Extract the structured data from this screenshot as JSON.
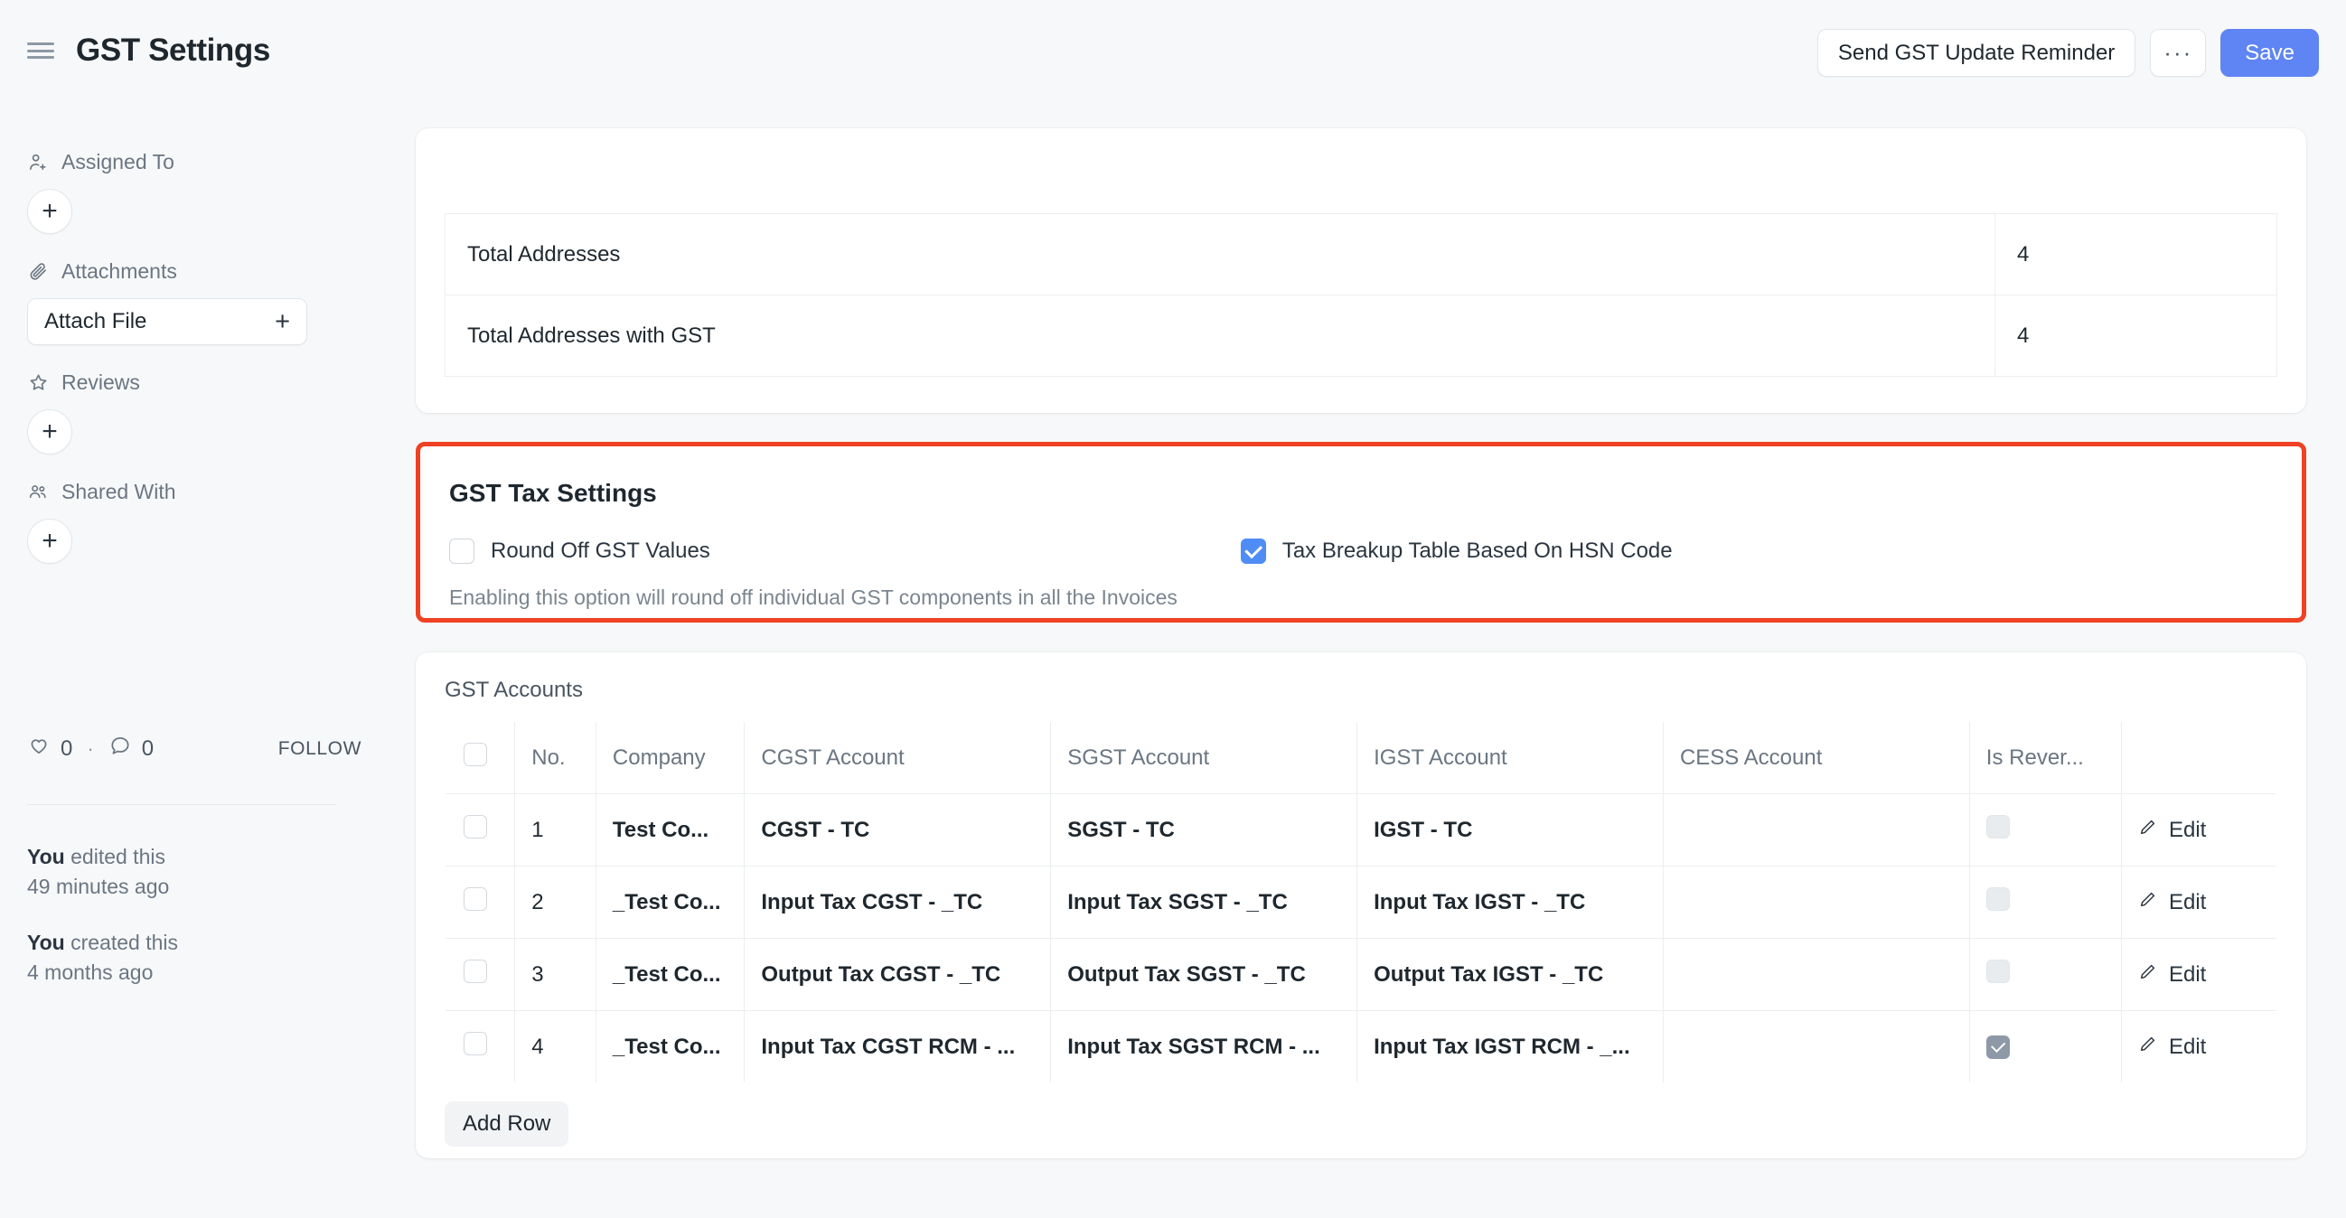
{
  "header": {
    "title": "GST Settings",
    "menu_icon": "hamburger-icon",
    "reminder_button": "Send GST Update Reminder",
    "more_button": "···",
    "save_button": "Save"
  },
  "sidebar": {
    "assigned_to": {
      "label": "Assigned To",
      "icon": "user-plus-icon",
      "add": "+"
    },
    "attachments": {
      "label": "Attachments",
      "icon": "paperclip-icon",
      "attach_label": "Attach File",
      "attach_plus": "+"
    },
    "reviews": {
      "label": "Reviews",
      "icon": "star-icon",
      "add": "+"
    },
    "shared_with": {
      "label": "Shared With",
      "icon": "users-icon",
      "add": "+"
    },
    "social": {
      "like_count": "0",
      "separator": "·",
      "comment_count": "0",
      "follow": "FOLLOW"
    },
    "activity": [
      {
        "who": "You",
        "action": " edited this",
        "time": "49 minutes ago"
      },
      {
        "who": "You",
        "action": " created this",
        "time": "4 months ago"
      }
    ]
  },
  "addresses": {
    "rows": [
      {
        "label": "Total Addresses",
        "value": "4"
      },
      {
        "label": "Total Addresses with GST",
        "value": "4"
      }
    ]
  },
  "gst_tax_settings": {
    "title": "GST Tax Settings",
    "highlight_color": "#ef4123",
    "accent_color": "#4f8df5",
    "round_off": {
      "label": "Round Off GST Values",
      "checked": false
    },
    "hsn_breakup": {
      "label": "Tax Breakup Table Based On HSN Code",
      "checked": true
    },
    "hint": "Enabling this option will round off individual GST components in all the Invoices"
  },
  "gst_accounts": {
    "title": "GST Accounts",
    "columns": [
      "",
      "No.",
      "Company",
      "CGST Account",
      "SGST Account",
      "IGST Account",
      "CESS Account",
      "Is Rever...",
      ""
    ],
    "rows": [
      {
        "no": "1",
        "company": "Test Co...",
        "cgst": "CGST - TC",
        "sgst": "SGST - TC",
        "igst": "IGST - TC",
        "cess": "",
        "is_reverse": false,
        "edit": "Edit"
      },
      {
        "no": "2",
        "company": "_Test Co...",
        "cgst": "Input Tax CGST - _TC",
        "sgst": "Input Tax SGST - _TC",
        "igst": "Input Tax IGST - _TC",
        "cess": "",
        "is_reverse": false,
        "edit": "Edit"
      },
      {
        "no": "3",
        "company": "_Test Co...",
        "cgst": "Output Tax CGST - _TC",
        "sgst": "Output Tax SGST - _TC",
        "igst": "Output Tax IGST - _TC",
        "cess": "",
        "is_reverse": false,
        "edit": "Edit"
      },
      {
        "no": "4",
        "company": "_Test Co...",
        "cgst": "Input Tax CGST RCM - ...",
        "sgst": "Input Tax SGST RCM - ...",
        "igst": "Input Tax IGST RCM - _...",
        "cess": "",
        "is_reverse": true,
        "edit": "Edit"
      }
    ],
    "add_row_button": "Add Row"
  }
}
